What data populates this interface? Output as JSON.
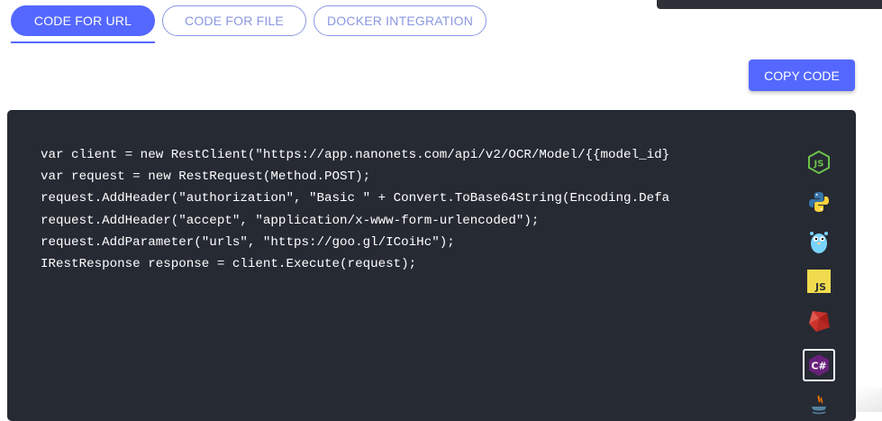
{
  "tabs": [
    {
      "label": "CODE FOR URL",
      "active": true
    },
    {
      "label": "CODE FOR FILE",
      "active": false
    },
    {
      "label": "DOCKER INTEGRATION",
      "active": false
    }
  ],
  "toolbar": {
    "copy_label": "COPY CODE"
  },
  "code": {
    "lines": [
      "var client = new RestClient(\"https://app.nanonets.com/api/v2/OCR/Model/{{model_id}",
      "var request = new RestRequest(Method.POST);",
      "request.AddHeader(\"authorization\", \"Basic \" + Convert.ToBase64String(Encoding.Defa",
      "request.AddHeader(\"accept\", \"application/x-www-form-urlencoded\");",
      "request.AddParameter(\"urls\", \"https://goo.gl/ICoiHc\");",
      "IRestResponse response = client.Execute(request);"
    ]
  },
  "languages": [
    {
      "icon": "nodejs-icon",
      "color": "#6cc24a",
      "label": "JS"
    },
    {
      "icon": "python-icon",
      "color": "#3776ab"
    },
    {
      "icon": "golang-icon",
      "color": "#79d4fd"
    },
    {
      "icon": "javascript-icon",
      "color": "#f0db4f",
      "label": "JS"
    },
    {
      "icon": "ruby-icon",
      "color": "#cc342d"
    },
    {
      "icon": "csharp-icon",
      "color": "#68217a",
      "label": "C#",
      "selected": true
    },
    {
      "icon": "java-icon",
      "color": "#e76f00"
    }
  ],
  "colors": {
    "accent": "#5468ff",
    "code_bg": "#262a33",
    "tab_inactive": "#8a97e0"
  }
}
